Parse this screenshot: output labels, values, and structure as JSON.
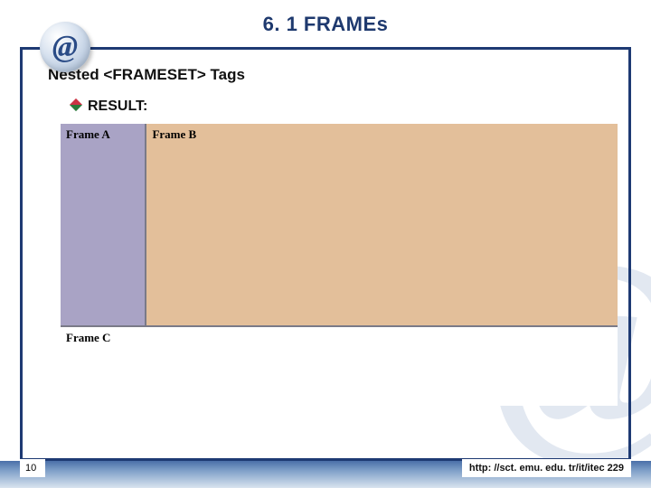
{
  "title": "6. 1 FRAMEs",
  "subtitle": "Nested <FRAMESET> Tags",
  "result_label": "RESULT:",
  "frames": {
    "a": "Frame A",
    "b": "Frame B",
    "c": "Frame C"
  },
  "page_number": "10",
  "url": "http: //sct. emu. edu. tr/it/itec 229",
  "icon_glyph": "@"
}
